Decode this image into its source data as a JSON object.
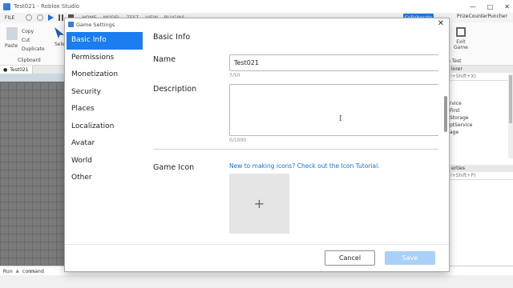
{
  "window": {
    "title": "Test021 - Roblox Studio"
  },
  "menubar": {
    "file": "FILE",
    "tabs": [
      "HOME",
      "MODEL",
      "TEST",
      "VIEW",
      "PLUGINS"
    ],
    "collaborate": "Collaborate",
    "user": "PrizeCounterPuncher"
  },
  "ribbon": {
    "paste": "Paste",
    "clip_items": [
      "Copy",
      "Cut",
      "Duplicate"
    ],
    "clipboard": "Clipboard",
    "select": "Selec",
    "exit_game": [
      "Exit",
      "Game"
    ],
    "run_test": "n Test"
  },
  "doc_tab": "Test021",
  "command_bar": {
    "placeholder": "Run a command"
  },
  "right_panel": {
    "explorer_header": "lorer",
    "explorer_filter": "l+Shift+X)",
    "explorer_items": [
      "rvice",
      "First",
      "Storage",
      "ptService",
      "age"
    ],
    "properties_header": "erties",
    "properties_filter": "l+Shift+P)"
  },
  "dialog": {
    "title": "Game Settings",
    "nav": [
      {
        "label": "Basic Info",
        "active": true
      },
      {
        "label": "Permissions"
      },
      {
        "label": "Monetization"
      },
      {
        "label": "Security"
      },
      {
        "label": "Places"
      },
      {
        "label": "Localization"
      },
      {
        "label": "Avatar"
      },
      {
        "label": "World"
      },
      {
        "label": "Other"
      }
    ],
    "section_title": "Basic Info",
    "name_label": "Name",
    "name_value": "Test021",
    "name_counter": "7/50",
    "description_label": "Description",
    "description_value": "",
    "description_counter": "0/1000",
    "game_icon_label": "Game Icon",
    "icon_tutorial_link": "New to making icons? Check out the Icon Tutorial.",
    "icon_upload_glyph": "+",
    "cancel": "Cancel",
    "save": "Save"
  }
}
